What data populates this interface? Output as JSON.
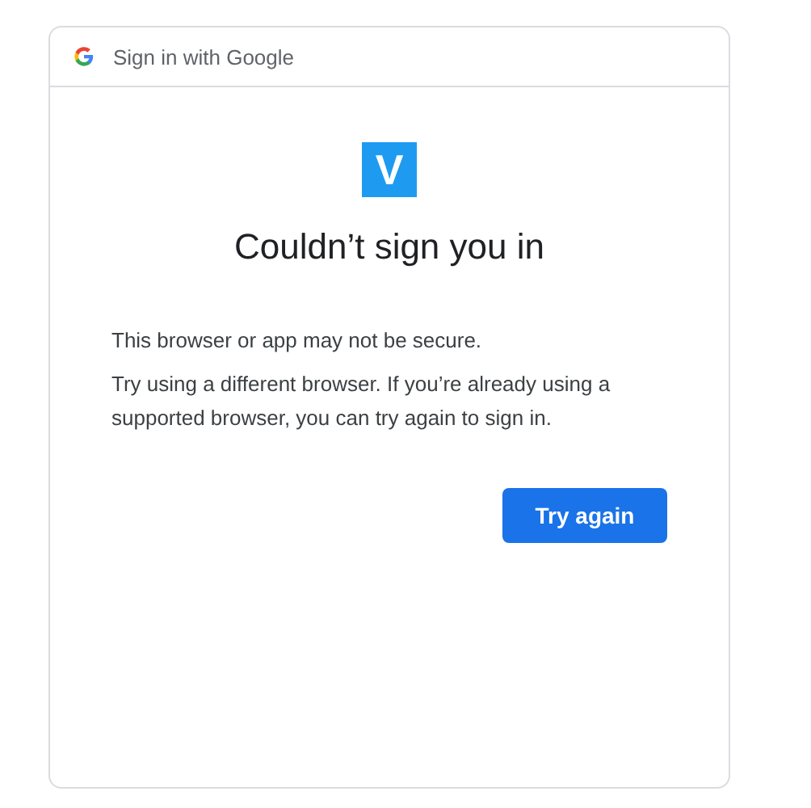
{
  "header": {
    "title": "Sign in with Google"
  },
  "app_logo": {
    "letter": "V"
  },
  "heading": "Couldn’t sign you in",
  "paragraphs": [
    "This browser or app may not be secure.",
    "Try using a different browser. If you’re already using a supported browser, you can try again to sign in."
  ],
  "buttons": [
    "Try again"
  ]
}
